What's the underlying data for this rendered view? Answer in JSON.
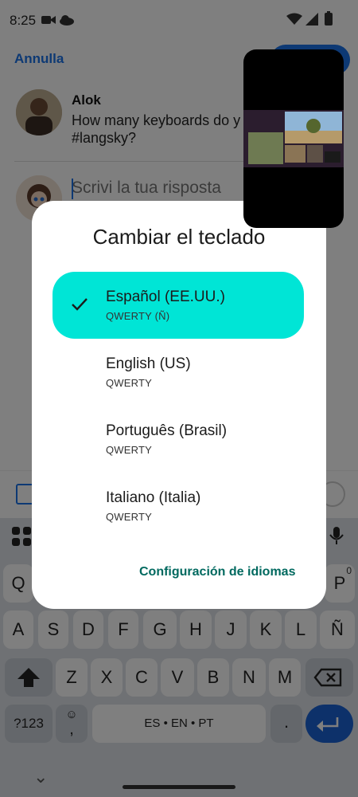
{
  "status": {
    "time": "8:25"
  },
  "header": {
    "cancel_label": "Annulla"
  },
  "post": {
    "author": "Alok",
    "text": "How many keyboards do y #langsky?"
  },
  "reply": {
    "placeholder": "Scrivi la tua risposta"
  },
  "dialog": {
    "title": "Cambiar el teclado",
    "options": [
      {
        "name": "Español (EE.UU.)",
        "layout": "QWERTY (Ñ)",
        "selected": true
      },
      {
        "name": "English (US)",
        "layout": "QWERTY",
        "selected": false
      },
      {
        "name": "Português (Brasil)",
        "layout": "QWERTY",
        "selected": false
      },
      {
        "name": "Italiano (Italia)",
        "layout": "QWERTY",
        "selected": false
      }
    ],
    "settings_link": "Configuración de idiomas"
  },
  "keyboard": {
    "row1_first": "Q",
    "row1_last": "P",
    "row1_last_hint": "0",
    "row2": [
      "A",
      "S",
      "D",
      "F",
      "G",
      "H",
      "J",
      "K",
      "L",
      "Ñ"
    ],
    "row3": [
      "Z",
      "X",
      "C",
      "V",
      "B",
      "N",
      "M"
    ],
    "sym_label": "?123",
    "comma": ",",
    "space_label": "ES • EN • PT",
    "period": "."
  },
  "colors": {
    "accent": "#1a73e8",
    "selected_option": "#00e5d6",
    "link": "#00695f"
  }
}
